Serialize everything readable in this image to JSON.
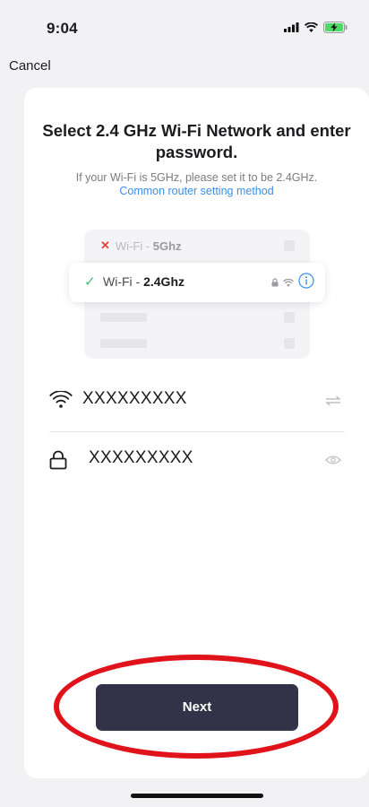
{
  "status_bar": {
    "time": "9:04"
  },
  "nav": {
    "cancel_label": "Cancel"
  },
  "header": {
    "title": "Select 2.4 GHz Wi-Fi Network and enter password.",
    "subtitle": "If your Wi-Fi is 5GHz, please set it to be 2.4GHz.",
    "help_link": "Common router setting method"
  },
  "illustration": {
    "bad_network": {
      "prefix": "Wi-Fi - ",
      "band": "5Ghz"
    },
    "good_network": {
      "prefix": "Wi-Fi - ",
      "band": "2.4Ghz"
    }
  },
  "form": {
    "wifi_name": "XXXXXXXXX",
    "password": "XXXXXXXXX"
  },
  "actions": {
    "next_label": "Next"
  },
  "colors": {
    "accent_link": "#3b8ee9",
    "button_bg": "#323349",
    "annotation_ring": "#e0121a",
    "ok_check": "#3cbf6c",
    "bad_x": "#e2443b"
  },
  "icons": [
    "signal-icon",
    "wifi-icon",
    "battery-charging-icon",
    "close-icon",
    "check-icon",
    "lock-icon",
    "info-icon",
    "switch-network-icon",
    "eye-icon"
  ]
}
